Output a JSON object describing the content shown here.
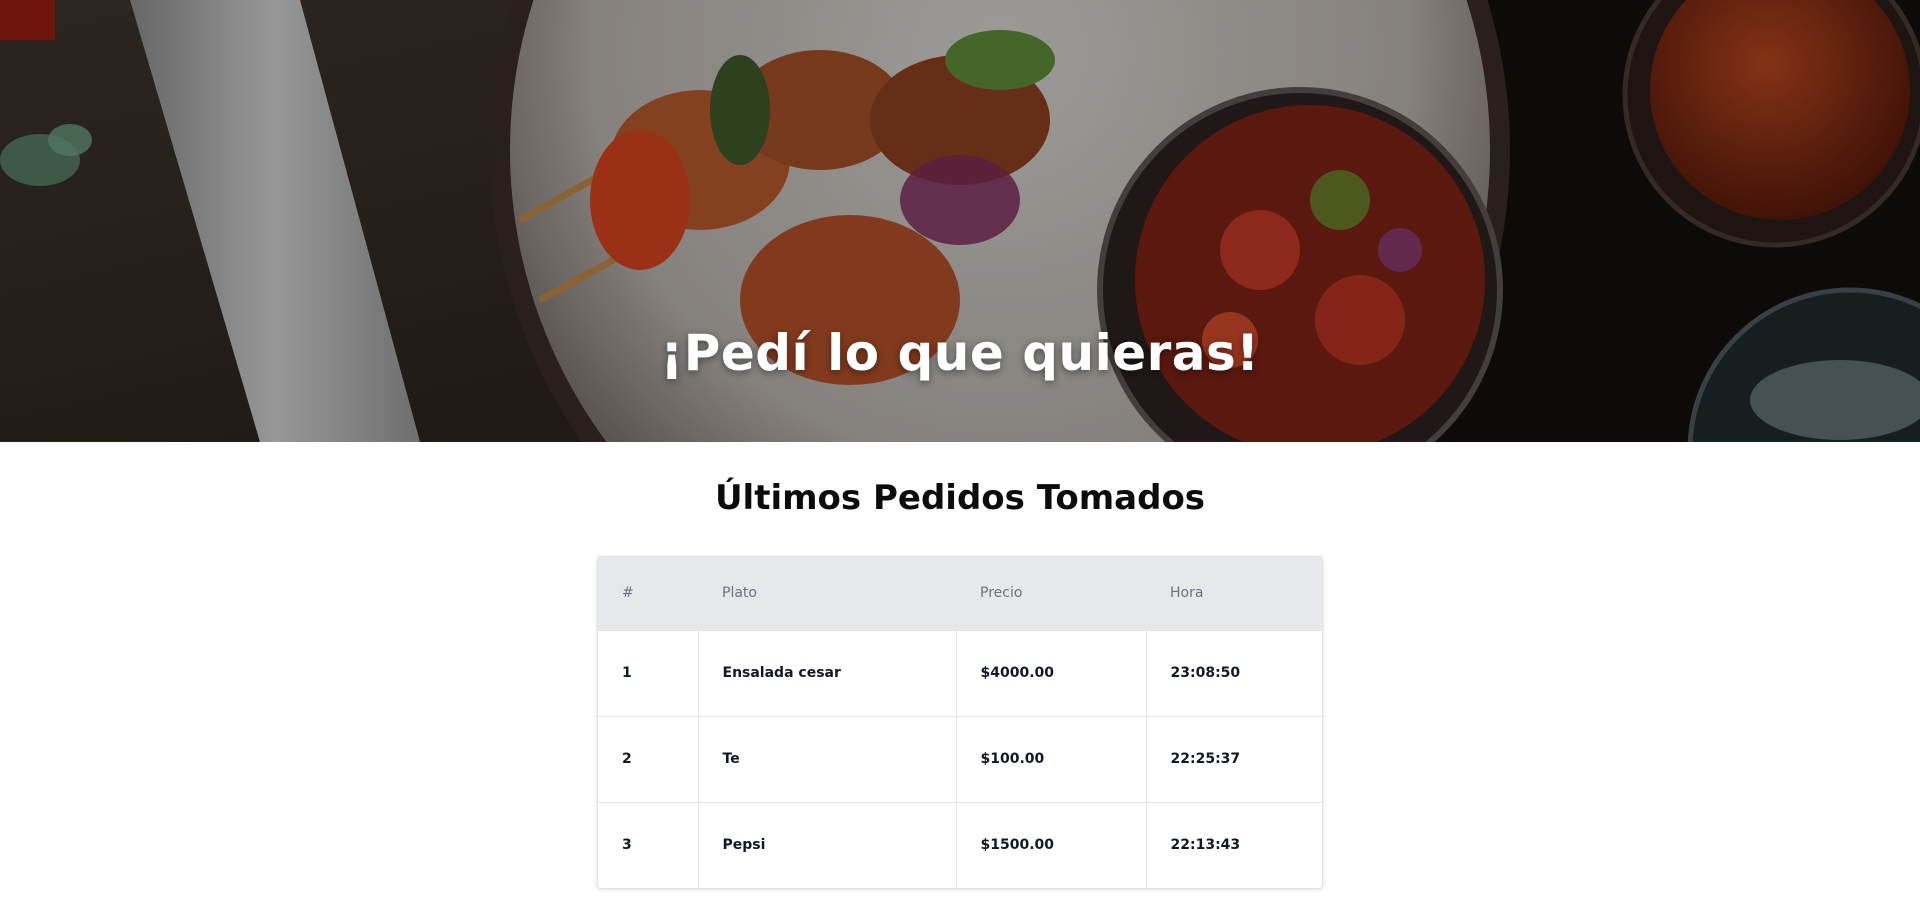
{
  "hero": {
    "title": "¡Pedí lo que quieras!",
    "image_icon": "food-photo-skewers"
  },
  "orders": {
    "title": "Últimos Pedidos Tomados",
    "columns": [
      "#",
      "Plato",
      "Precio",
      "Hora"
    ],
    "rows": [
      {
        "num": "1",
        "plato": "Ensalada cesar",
        "precio": "$4000.00",
        "hora": "23:08:50"
      },
      {
        "num": "2",
        "plato": "Te",
        "precio": "$100.00",
        "hora": "22:25:37"
      },
      {
        "num": "3",
        "plato": "Pepsi",
        "precio": "$1500.00",
        "hora": "22:13:43"
      }
    ]
  },
  "colors": {
    "header_bg": "#e6e8ec",
    "header_text": "#6b7280",
    "body_text": "#111827",
    "border": "#e3e4e8"
  }
}
